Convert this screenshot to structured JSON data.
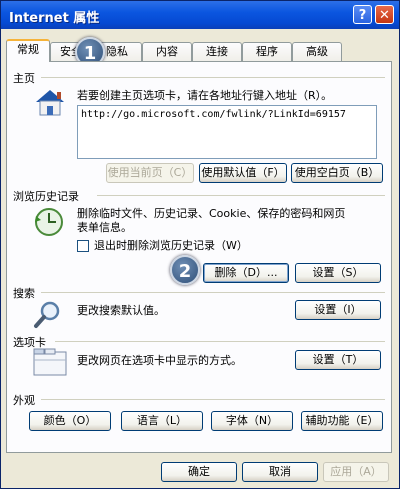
{
  "window": {
    "title": "Internet 属性",
    "help_glyph": "?",
    "close_glyph": "✕"
  },
  "tabs": [
    {
      "label": "常规",
      "active": true
    },
    {
      "label": "安全"
    },
    {
      "label": "隐私"
    },
    {
      "label": "内容"
    },
    {
      "label": "连接"
    },
    {
      "label": "程序"
    },
    {
      "label": "高级"
    }
  ],
  "homepage": {
    "title": "主页",
    "description": "若要创建主页选项卡，请在各地址行键入地址（R）。",
    "url": "http://go.microsoft.com/fwlink/?LinkId=69157",
    "use_current": "使用当前页（C）",
    "use_default": "使用默认值（F）",
    "use_blank": "使用空白页（B）"
  },
  "history": {
    "title": "浏览历史记录",
    "description_line1": "删除临时文件、历史记录、Cookie、保存的密码和网页",
    "description_line2": "表单信息。",
    "checkbox_label": "退出时删除浏览历史记录（W）",
    "delete_button": "删除（D）...",
    "settings_button": "设置（S）"
  },
  "search": {
    "title": "搜索",
    "description": "更改搜索默认值。",
    "settings_button": "设置（I）"
  },
  "tabsection": {
    "title": "选项卡",
    "description": "更改网页在选项卡中显示的方式。",
    "settings_button": "设置（T）"
  },
  "appearance": {
    "title": "外观",
    "colors": "颜色（O）",
    "languages": "语言（L）",
    "fonts": "字体（N）",
    "accessibility": "辅助功能（E）"
  },
  "footer": {
    "ok": "确定",
    "cancel": "取消",
    "apply": "应用（A）"
  },
  "markers": {
    "first": "1",
    "second": "2"
  }
}
